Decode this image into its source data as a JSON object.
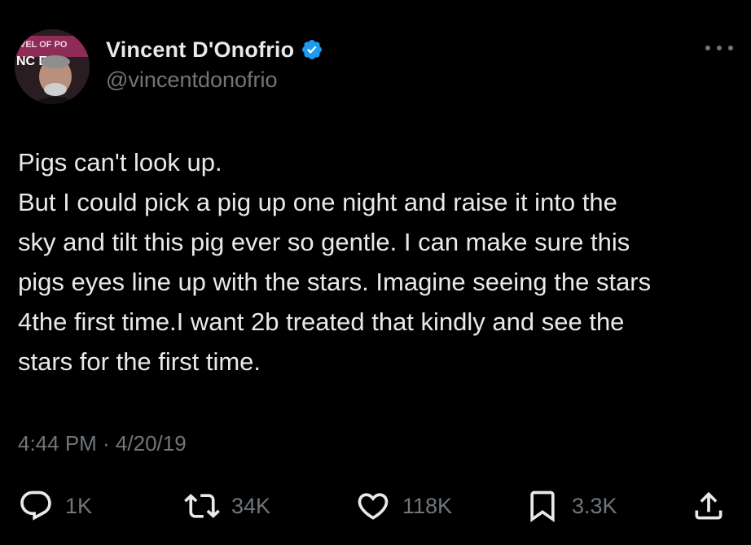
{
  "author": {
    "display_name": "Vincent D'Onofrio",
    "handle": "@vincentdonofrio",
    "verified": true,
    "avatar_icon": "profile-photo"
  },
  "tweet": {
    "text": "Pigs can't look up.\nBut I could pick a pig up one night and raise it into the\nsky and tilt this pig ever so gentle. I can make sure this\npigs eyes line up with the stars. Imagine seeing the stars\n4the first time.I want 2b treated that kindly and see the\nstars for the first time.",
    "timestamp": "4:44 PM · 4/20/19"
  },
  "actions": {
    "reply": {
      "icon": "reply-icon",
      "count": "1K"
    },
    "repost": {
      "icon": "repost-icon",
      "count": "34K"
    },
    "like": {
      "icon": "heart-icon",
      "count": "118K"
    },
    "bookmark": {
      "icon": "bookmark-icon",
      "count": "3.3K"
    },
    "share": {
      "icon": "share-icon"
    }
  },
  "colors": {
    "background": "#000000",
    "primary_text": "#e7e9ea",
    "secondary_text": "#71767b",
    "verified_badge": "#1d9bf0"
  }
}
